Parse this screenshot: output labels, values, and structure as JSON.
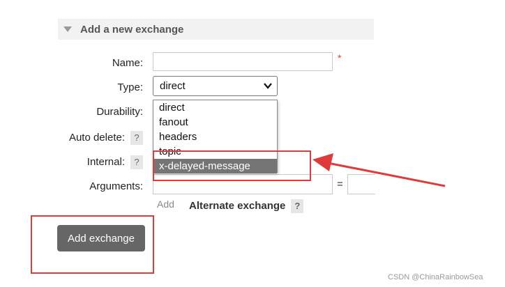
{
  "section": {
    "title": "Add a new exchange"
  },
  "form": {
    "name_label": "Name:",
    "required_mark": "*",
    "type_label": "Type:",
    "type_selected": "direct",
    "durability_label": "Durability:",
    "auto_delete_label": "Auto delete:",
    "internal_label": "Internal:",
    "arguments_label": "Arguments:",
    "help_glyph": "?",
    "equals": "=",
    "add_link": "Add",
    "alternate_exchange": "Alternate exchange"
  },
  "dropdown": {
    "options": [
      "direct",
      "fanout",
      "headers",
      "topic",
      "x-delayed-message"
    ],
    "highlighted": "x-delayed-message"
  },
  "actions": {
    "add_exchange": "Add exchange"
  },
  "annotations": {
    "color": "#e03a3a"
  },
  "watermark": "CSDN @ChinaRainbowSea"
}
